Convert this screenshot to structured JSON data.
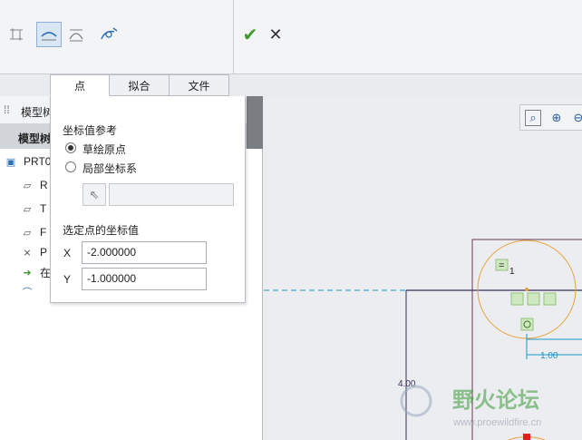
{
  "ribbon": {
    "icons": [
      {
        "name": "point-icon-disabled",
        "active": false
      },
      {
        "name": "spline-curve-icon",
        "active": true
      },
      {
        "name": "tangency-icon",
        "active": false
      },
      {
        "name": "sketch-settings-icon",
        "active": false
      }
    ],
    "ok_icon": "check-icon",
    "cancel_icon": "close-icon"
  },
  "tabs": [
    "点",
    "拟合",
    "文件"
  ],
  "model_tree": {
    "header1": "模型树",
    "header2": "模型树",
    "items": [
      {
        "icon": "part-icon",
        "label": "PRT0"
      },
      {
        "icon": "datum-plane-icon",
        "label": "R"
      },
      {
        "icon": "datum-plane-icon",
        "label": "T"
      },
      {
        "icon": "datum-plane-icon",
        "label": "F"
      },
      {
        "icon": "csys-icon",
        "label": "P"
      },
      {
        "icon": "insert-here-icon",
        "label": "在"
      },
      {
        "icon": "sketch-icon",
        "label": ""
      }
    ]
  },
  "point_panel": {
    "ref_title": "坐标值参考",
    "option_origin": "草绘原点",
    "option_local": "局部坐标系",
    "value_title": "选定点的坐标值",
    "x_label": "X",
    "x_value": "-2.000000",
    "y_label": "Y",
    "y_value": "-1.000000"
  },
  "graphics": {
    "dim_vertical": "4.00",
    "dim_horizontal": "1.00",
    "constraint_equal": "=",
    "constraint_index": "1",
    "watermark_title": "野火论坛",
    "watermark_url": "www.proewildfire.cn"
  },
  "colors": {
    "sketch_orange": "#e8a23a",
    "dimension_cyan": "#1696c8",
    "outline_purple": "#6a3b52",
    "ok_green": "#3d9a2a"
  }
}
